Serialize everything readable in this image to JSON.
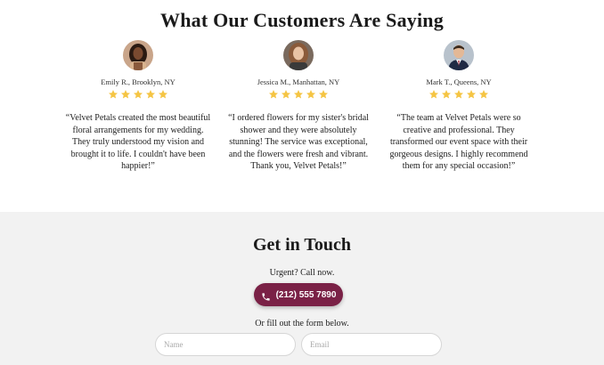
{
  "testimonials": {
    "title": "What Our Customers Are Saying",
    "items": [
      {
        "name": "Emily R., Brooklyn, NY",
        "rating": 5,
        "quote": "“Velvet Petals created the most beautiful floral arrangements for my wedding. They truly understood my vision and brought it to life. I couldn't have been happier!”"
      },
      {
        "name": "Jessica M., Manhattan, NY",
        "rating": 5,
        "quote": "“I ordered flowers for my sister's bridal shower and they were absolutely stunning! The service was exceptional, and the flowers were fresh and vibrant. Thank you, Velvet Petals!”"
      },
      {
        "name": "Mark T., Queens, NY",
        "rating": 5,
        "quote": "“The team at Velvet Petals were so creative and professional. They transformed our event space with their gorgeous designs. I highly recommend them for any special occasion!”"
      }
    ]
  },
  "contact": {
    "title": "Get in Touch",
    "urgent_text": "Urgent? Call now.",
    "call_button_label": "(212) 555 7890",
    "call_icon": "phone-icon",
    "form_intro": "Or fill out the form below.",
    "name_placeholder": "Name",
    "email_placeholder": "Email"
  },
  "colors": {
    "accent": "#7a2146",
    "star": "#f5c544",
    "contact_bg": "#f2f2f2"
  }
}
